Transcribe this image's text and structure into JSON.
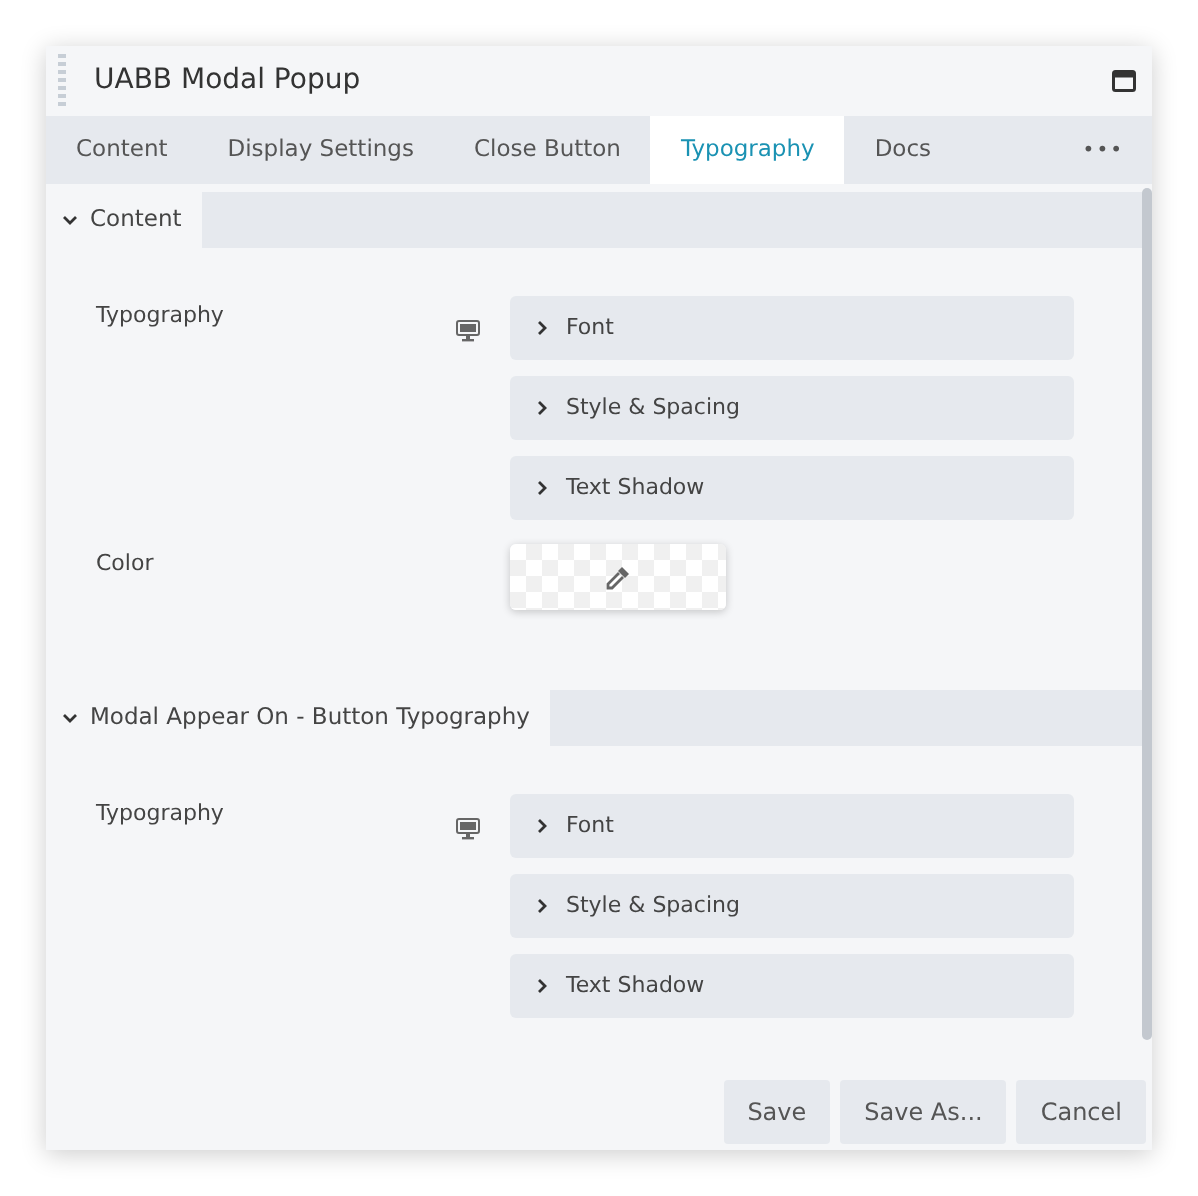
{
  "window": {
    "title": "UABB Modal Popup"
  },
  "tabs": [
    {
      "label": "Content",
      "selected": false
    },
    {
      "label": "Display Settings",
      "selected": false
    },
    {
      "label": "Close Button",
      "selected": false
    },
    {
      "label": "Typography",
      "selected": true
    },
    {
      "label": "Docs",
      "selected": false
    }
  ],
  "tabs_more": "•••",
  "sections": [
    {
      "title": "Content",
      "expanded": true,
      "fields": [
        {
          "kind": "typography",
          "label": "Typography",
          "items": [
            {
              "label": "Font",
              "expanded": false
            },
            {
              "label": "Style & Spacing",
              "expanded": false
            },
            {
              "label": "Text Shadow",
              "expanded": false
            }
          ]
        },
        {
          "kind": "color",
          "label": "Color"
        }
      ]
    },
    {
      "title": "Modal Appear On - Button Typography",
      "expanded": true,
      "fields": [
        {
          "kind": "typography",
          "label": "Typography",
          "items": [
            {
              "label": "Font",
              "expanded": false
            },
            {
              "label": "Style & Spacing",
              "expanded": false
            },
            {
              "label": "Text Shadow",
              "expanded": false
            }
          ]
        }
      ]
    }
  ],
  "buttons": [
    "Save",
    "Save As...",
    "Cancel"
  ]
}
